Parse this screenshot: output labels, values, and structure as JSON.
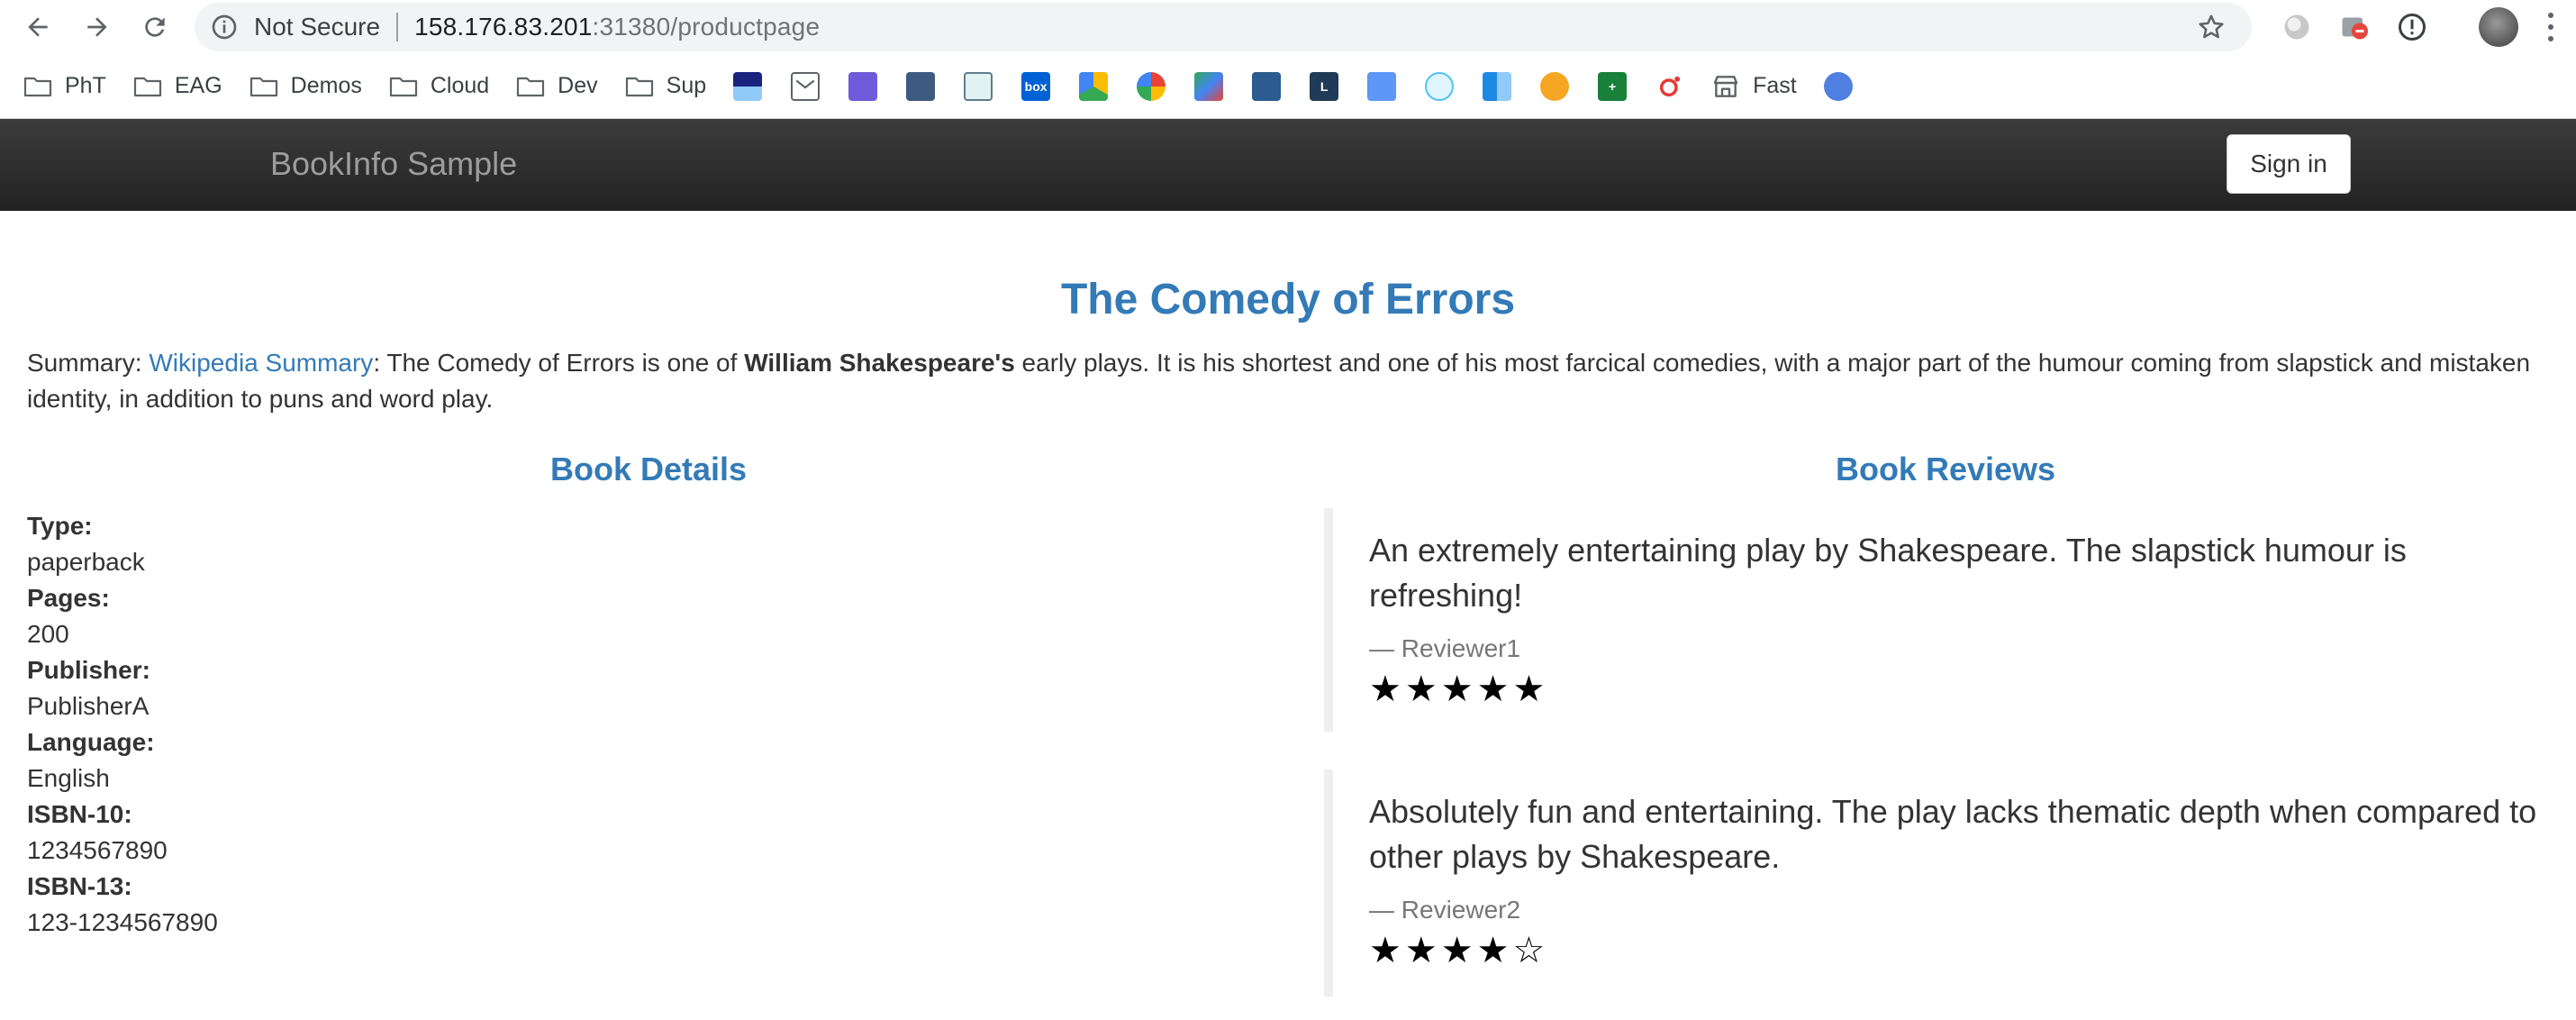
{
  "browser": {
    "security_label": "Not Secure",
    "url_host": "158.176.83.201",
    "url_rest": ":31380/productpage"
  },
  "bookmarks": [
    {
      "label": "PhT",
      "kind": "folder"
    },
    {
      "label": "EAG",
      "kind": "folder"
    },
    {
      "label": "Demos",
      "kind": "folder"
    },
    {
      "label": "Cloud",
      "kind": "folder"
    },
    {
      "label": "Dev",
      "kind": "folder"
    },
    {
      "label": "Sup",
      "kind": "folder"
    },
    {
      "label": "Fast",
      "kind": "link"
    }
  ],
  "navbar": {
    "brand": "BookInfo Sample",
    "signin_label": "Sign in"
  },
  "book": {
    "title": "The Comedy of Errors",
    "summary_prefix": "Summary: ",
    "summary_link": "Wikipedia Summary",
    "summary_mid": ": The Comedy of Errors is one of ",
    "summary_bold": "William Shakespeare's",
    "summary_rest": " early plays. It is his shortest and one of his most farcical comedies, with a major part of the humour coming from slapstick and mistaken identity, in addition to puns and word play."
  },
  "details": {
    "heading": "Book Details",
    "type_label": "Type:",
    "type_value": "paperback",
    "pages_label": "Pages:",
    "pages_value": "200",
    "publisher_label": "Publisher:",
    "publisher_value": "PublisherA",
    "language_label": "Language:",
    "language_value": "English",
    "isbn10_label": "ISBN-10:",
    "isbn10_value": "1234567890",
    "isbn13_label": "ISBN-13:",
    "isbn13_value": "123-1234567890"
  },
  "reviews": {
    "heading": "Book Reviews",
    "items": [
      {
        "text": "An extremely entertaining play by Shakespeare. The slapstick humour is refreshing!",
        "author": "— Reviewer1",
        "rating": 5,
        "stars": "★★★★★"
      },
      {
        "text": "Absolutely fun and entertaining. The play lacks thematic depth when compared to other plays by Shakespeare.",
        "author": "— Reviewer2",
        "rating": 4,
        "stars": "★★★★☆"
      }
    ]
  },
  "colors": {
    "link": "#337ab7",
    "navbar": "#222222",
    "brand": "#9d9d9d"
  }
}
